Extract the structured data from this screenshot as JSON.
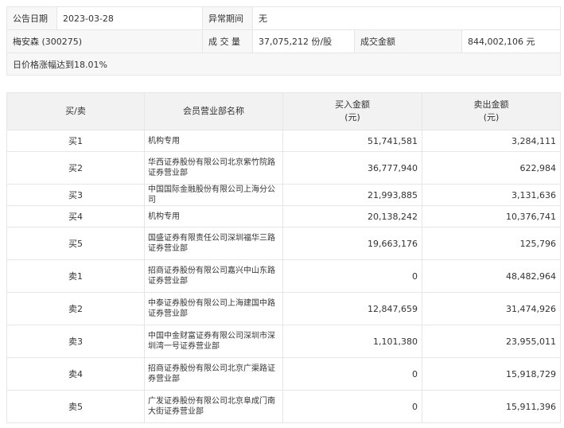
{
  "info": {
    "date_label": "公告日期",
    "date_value": "2023-03-28",
    "period_label": "异常期间",
    "period_value": "无",
    "stock_label": "梅安森 (300275)",
    "volume_label": "成 交 量",
    "volume_value": "37,075,212 份/股",
    "amount_label": "成交金额",
    "amount_value": "844,002,106 元",
    "reason": "日价格涨幅达到18.01%"
  },
  "table": {
    "headers": {
      "side": "买/卖",
      "dept": "会员营业部名称",
      "buy": "买入金额\n(元)",
      "sell": "卖出金额\n(元)"
    },
    "rows": [
      {
        "side": "买1",
        "name": "机构专用",
        "buy": "51,741,581",
        "sell": "3,284,111"
      },
      {
        "side": "买2",
        "name": "华西证券股份有限公司北京紫竹院路证券营业部",
        "buy": "36,777,940",
        "sell": "622,984"
      },
      {
        "side": "买3",
        "name": "中国国际金融股份有限公司上海分公司",
        "buy": "21,993,885",
        "sell": "3,131,636"
      },
      {
        "side": "买4",
        "name": "机构专用",
        "buy": "20,138,242",
        "sell": "10,376,741"
      },
      {
        "side": "买5",
        "name": "国盛证券有限责任公司深圳福华三路证券营业部",
        "buy": "19,663,176",
        "sell": "125,796"
      },
      {
        "side": "卖1",
        "name": "招商证券股份有限公司嘉兴中山东路证券营业部",
        "buy": "0",
        "sell": "48,482,964"
      },
      {
        "side": "卖2",
        "name": "中泰证券股份有限公司上海建国中路证券营业部",
        "buy": "12,847,659",
        "sell": "31,474,926"
      },
      {
        "side": "卖3",
        "name": "中国中金财富证券有限公司深圳市深圳湾一号证券营业部",
        "buy": "1,101,380",
        "sell": "23,955,011"
      },
      {
        "side": "卖4",
        "name": "招商证券股份有限公司北京广渠路证券营业部",
        "buy": "0",
        "sell": "15,918,729"
      },
      {
        "side": "卖5",
        "name": "广发证券股份有限公司北京阜成门南大街证券营业部",
        "buy": "0",
        "sell": "15,911,396"
      }
    ]
  }
}
